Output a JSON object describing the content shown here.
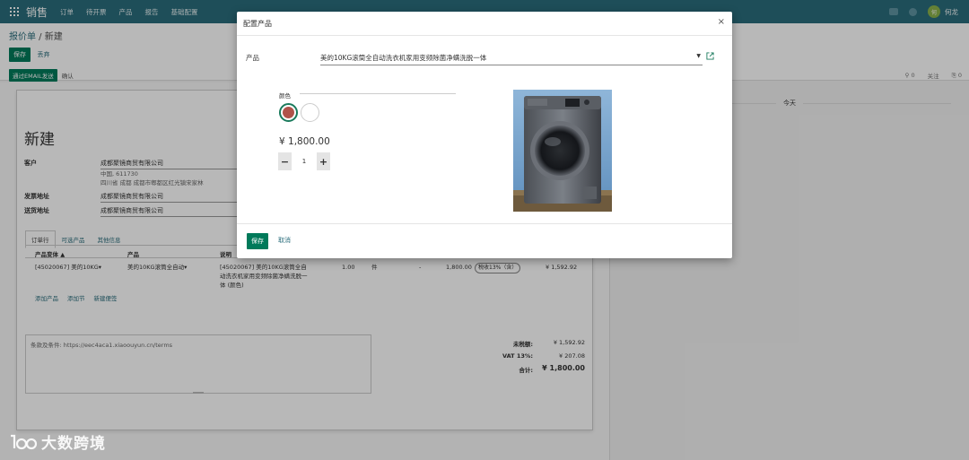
{
  "topbar": {
    "app_name": "销售",
    "nav": [
      "订单",
      "待开票",
      "产品",
      "报告",
      "基础配置"
    ],
    "user": "何龙",
    "avatar_text": "何"
  },
  "control": {
    "breadcrumb_parent": "报价单",
    "breadcrumb_sep": " / ",
    "breadcrumb_current": "新建",
    "save_label": "保存",
    "discard_label": "丢弃"
  },
  "statusbar": {
    "send_email_label": "通过EMAIL发送",
    "confirm_label": "确认"
  },
  "chatter": {
    "followers_count": "0",
    "follow_label": "关注",
    "attachments_count": "0",
    "today_label": "今天"
  },
  "form": {
    "title": "新建",
    "customer_label": "客户",
    "customer_value": "成都聚镜商贸有限公司",
    "customer_address_line1": "中国, 611730",
    "customer_address_line2": "四川省 成都 成都市郫都区红光镇宋家林",
    "invoice_label": "发票地址",
    "invoice_value": "成都聚镜商贸有限公司",
    "delivery_label": "送货地址",
    "delivery_value": "成都聚镜商贸有限公司",
    "tabs": [
      "订单行",
      "可选产品",
      "其他信息"
    ],
    "columns": [
      "产品变体 ▲",
      "产品",
      "说明"
    ],
    "line": {
      "variant": "[45020067] 美的10KG▾",
      "product": "美的10KG滚筒全自动▾",
      "description": "[45020067] 美的10KG滚筒全自动洗衣机家用变频除菌净螨洗脱一体 (颜色)",
      "quantity": "1.00",
      "uom": "件",
      "discount": "-",
      "unit_price": "1,800.00",
      "tax": "税收13%（含）",
      "subtotal": "¥ 1,592.92"
    },
    "add_links": [
      "添加产品",
      "添加节",
      "新建便签"
    ],
    "terms": "条款及条件: https://eec4aca1.xiaoouyun.cn/terms",
    "untaxed_label": "未税额:",
    "untaxed_value": "¥ 1,592.92",
    "vat_label": "VAT 13%:",
    "vat_value": "¥ 207.08",
    "total_label": "合计:",
    "total_value": "¥ 1,800.00"
  },
  "modal": {
    "title": "配置产品",
    "close": "×",
    "product_label": "产品",
    "product_value": "美的10KG滚筒全自动洗衣机家用变频除菌净螨洗脱一体",
    "attribute_label": "颜色",
    "swatch_colors": [
      "#b0524a",
      "#ffffff"
    ],
    "price": "¥ 1,800.00",
    "minus": "−",
    "quantity": "1",
    "plus": "+",
    "save_label": "保存",
    "cancel_label": "取消"
  },
  "watermark": {
    "text": "大数跨境"
  }
}
